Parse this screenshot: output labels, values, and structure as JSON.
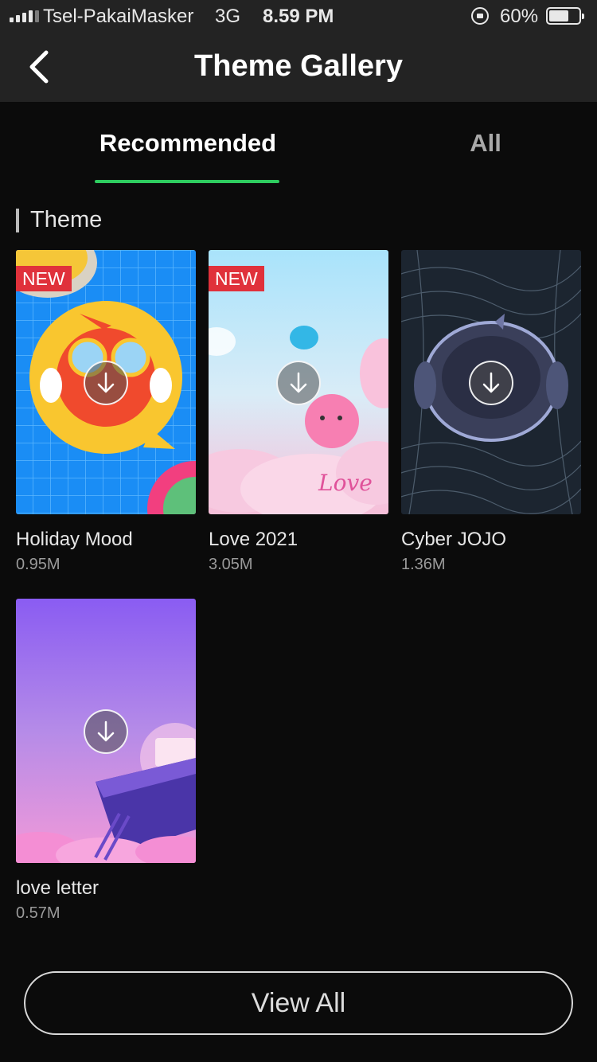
{
  "status": {
    "carrier": "Tsel-PakaiMasker",
    "network": "3G",
    "time": "8.59 PM",
    "battery": "60%",
    "battery_level": 0.6
  },
  "header": {
    "title": "Theme Gallery",
    "back_icon": "chevron-left-icon"
  },
  "tabs": [
    {
      "label": "Recommended",
      "active": true
    },
    {
      "label": "All",
      "active": false
    }
  ],
  "section": {
    "title": "Theme"
  },
  "themes": [
    {
      "name": "Holiday Mood",
      "size": "0.95M",
      "badge": "NEW"
    },
    {
      "name": "Love 2021",
      "size": "3.05M",
      "badge": "NEW",
      "art_text": "Love"
    },
    {
      "name": "Cyber JOJO",
      "size": "1.36M"
    },
    {
      "name": "love letter",
      "size": "0.57M"
    }
  ],
  "footer": {
    "view_all_label": "View All"
  },
  "colors": {
    "accent": "#2ecc5f",
    "badge": "#e0313b",
    "background": "#0b0b0b",
    "bar": "#232323"
  }
}
